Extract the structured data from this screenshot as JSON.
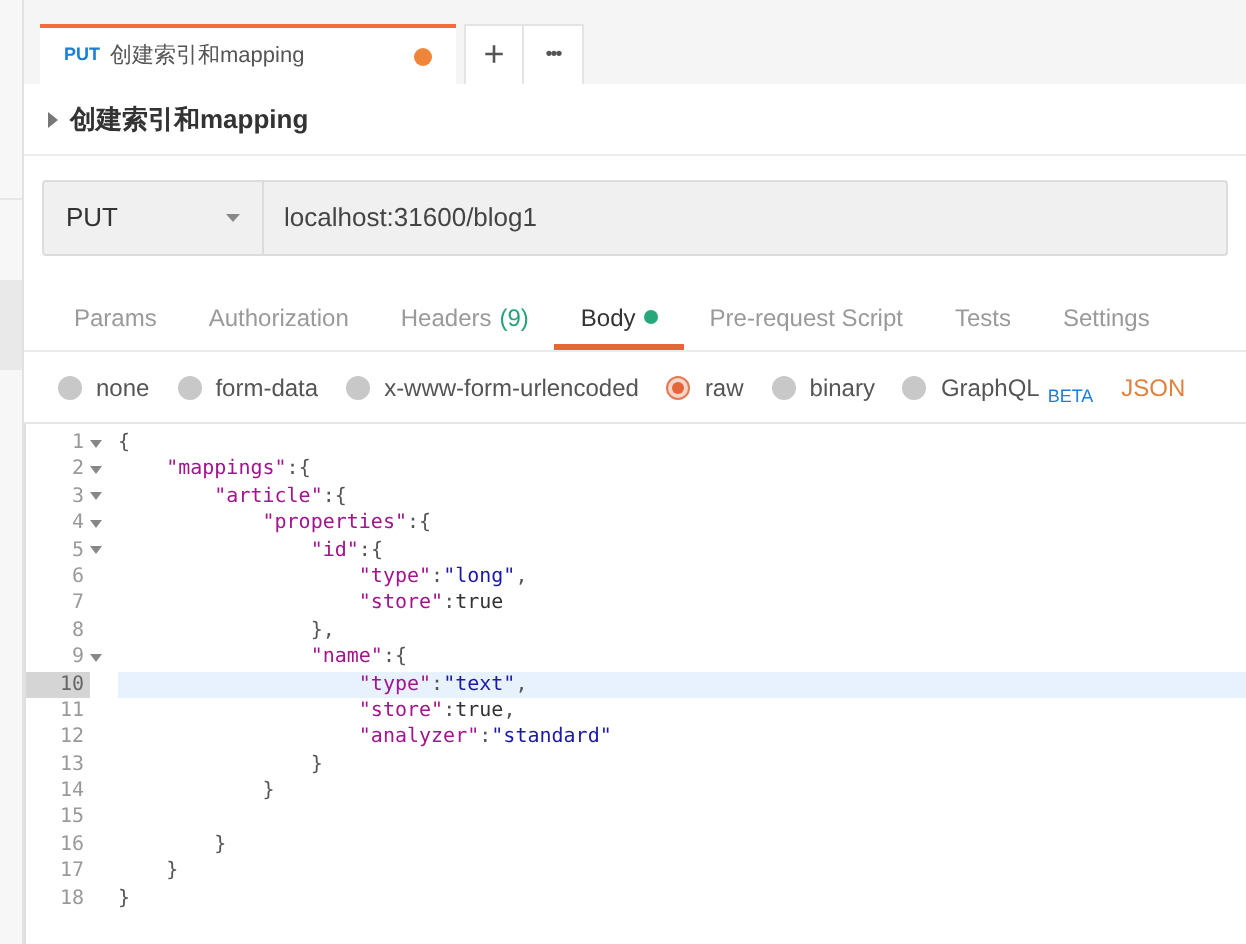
{
  "request_tab": {
    "method": "PUT",
    "title": "创建索引和mapping",
    "unsaved": true
  },
  "tab_actions": [
    "+",
    "•••"
  ],
  "request_name": "创建索引和mapping",
  "url_bar": {
    "method": "PUT",
    "url": "localhost:31600/blog1"
  },
  "tabs": [
    {
      "label": "Params",
      "selected": false
    },
    {
      "label": "Authorization",
      "selected": false
    },
    {
      "label": "Headers",
      "count": "(9)",
      "selected": false
    },
    {
      "label": "Body",
      "selected": true,
      "dot": true
    },
    {
      "label": "Pre-request Script",
      "selected": false
    },
    {
      "label": "Tests",
      "selected": false
    },
    {
      "label": "Settings",
      "selected": false
    }
  ],
  "body_types": [
    {
      "label": "none",
      "selected": false
    },
    {
      "label": "form-data",
      "selected": false
    },
    {
      "label": "x-www-form-urlencoded",
      "selected": false
    },
    {
      "label": "raw",
      "selected": true
    },
    {
      "label": "binary",
      "selected": false
    },
    {
      "label": "GraphQL",
      "badge": "BETA",
      "selected": false
    }
  ],
  "raw_format": "JSON",
  "editor_lines": [
    {
      "number": "1",
      "foldable": true,
      "highlighted": false,
      "tokens": [
        {
          "kind": "punct",
          "text": "{"
        }
      ]
    },
    {
      "number": "2",
      "foldable": true,
      "highlighted": false,
      "tokens": [
        {
          "kind": "key",
          "text": "    \"mappings\""
        },
        {
          "kind": "punct",
          "text": ":{"
        }
      ]
    },
    {
      "number": "3",
      "foldable": true,
      "highlighted": false,
      "tokens": [
        {
          "kind": "key",
          "text": "        \"article\""
        },
        {
          "kind": "punct",
          "text": ":{"
        }
      ]
    },
    {
      "number": "4",
      "foldable": true,
      "highlighted": false,
      "tokens": [
        {
          "kind": "key",
          "text": "            \"properties\""
        },
        {
          "kind": "punct",
          "text": ":{"
        }
      ]
    },
    {
      "number": "5",
      "foldable": true,
      "highlighted": false,
      "tokens": [
        {
          "kind": "key",
          "text": "                \"id\""
        },
        {
          "kind": "punct",
          "text": ":{"
        }
      ]
    },
    {
      "number": "6",
      "foldable": false,
      "highlighted": false,
      "tokens": [
        {
          "kind": "key",
          "text": "                    \"type\""
        },
        {
          "kind": "punct",
          "text": ":"
        },
        {
          "kind": "string",
          "text": "\"long\""
        },
        {
          "kind": "punct",
          "text": ","
        }
      ]
    },
    {
      "number": "7",
      "foldable": false,
      "highlighted": false,
      "tokens": [
        {
          "kind": "key",
          "text": "                    \"store\""
        },
        {
          "kind": "punct",
          "text": ":"
        },
        {
          "kind": "literal",
          "text": "true"
        }
      ]
    },
    {
      "number": "8",
      "foldable": false,
      "highlighted": false,
      "tokens": [
        {
          "kind": "punct",
          "text": "                },"
        }
      ]
    },
    {
      "number": "9",
      "foldable": true,
      "highlighted": false,
      "tokens": [
        {
          "kind": "key",
          "text": "                \"name\""
        },
        {
          "kind": "punct",
          "text": ":{"
        }
      ]
    },
    {
      "number": "10",
      "foldable": false,
      "highlighted": true,
      "tokens": [
        {
          "kind": "key",
          "text": "                    \"type\""
        },
        {
          "kind": "punct",
          "text": ":"
        },
        {
          "kind": "string",
          "text": "\"text\""
        },
        {
          "kind": "punct",
          "text": ","
        }
      ]
    },
    {
      "number": "11",
      "foldable": false,
      "highlighted": false,
      "tokens": [
        {
          "kind": "key",
          "text": "                    \"store\""
        },
        {
          "kind": "punct",
          "text": ":"
        },
        {
          "kind": "literal",
          "text": "true"
        },
        {
          "kind": "punct",
          "text": ","
        }
      ]
    },
    {
      "number": "12",
      "foldable": false,
      "highlighted": false,
      "tokens": [
        {
          "kind": "key",
          "text": "                    \"analyzer\""
        },
        {
          "kind": "punct",
          "text": ":"
        },
        {
          "kind": "string",
          "text": "\"standard\""
        }
      ]
    },
    {
      "number": "13",
      "foldable": false,
      "highlighted": false,
      "tokens": [
        {
          "kind": "punct",
          "text": "                }"
        }
      ]
    },
    {
      "number": "14",
      "foldable": false,
      "highlighted": false,
      "tokens": [
        {
          "kind": "punct",
          "text": "            }"
        }
      ]
    },
    {
      "number": "15",
      "foldable": false,
      "highlighted": false
    },
    {
      "number": "16",
      "foldable": false,
      "highlighted": false,
      "tokens": [
        {
          "kind": "punct",
          "text": "        }"
        }
      ]
    },
    {
      "number": "17",
      "foldable": false,
      "highlighted": false,
      "tokens": [
        {
          "kind": "punct",
          "text": "    }"
        }
      ]
    },
    {
      "number": "18",
      "foldable": false,
      "highlighted": false,
      "tokens": [
        {
          "kind": "punct",
          "text": "}"
        }
      ]
    }
  ]
}
